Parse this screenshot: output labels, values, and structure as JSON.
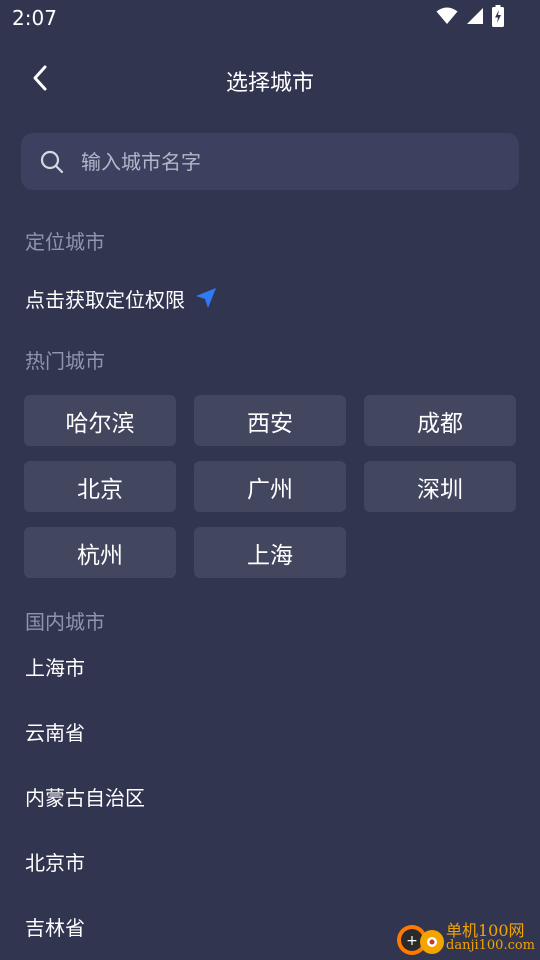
{
  "status_bar": {
    "time": "2:07",
    "icons": [
      "wifi-icon",
      "signal-icon",
      "battery-charging-icon"
    ]
  },
  "header": {
    "title": "选择城市",
    "back_icon": "chevron-left-icon"
  },
  "search": {
    "placeholder": "输入城市名字",
    "value": "",
    "icon": "search-icon"
  },
  "location": {
    "section_label": "定位城市",
    "action_text": "点击获取定位权限",
    "icon": "location-arrow-icon",
    "icon_color": "#2f7bf5"
  },
  "hot_cities": {
    "section_label": "热门城市",
    "items": [
      "哈尔滨",
      "西安",
      "成都",
      "北京",
      "广州",
      "深圳",
      "杭州",
      "上海"
    ]
  },
  "domestic": {
    "section_label": "国内城市",
    "items": [
      "上海市",
      "云南省",
      "内蒙古自治区",
      "北京市",
      "吉林省"
    ]
  },
  "watermark": {
    "line1": "单机100网",
    "line2": "danji100.com"
  },
  "colors": {
    "background": "#323550",
    "chip": "#42465f",
    "search_box": "#3d4160",
    "section_label": "#8f93ab",
    "watermark": "#f2a400"
  }
}
